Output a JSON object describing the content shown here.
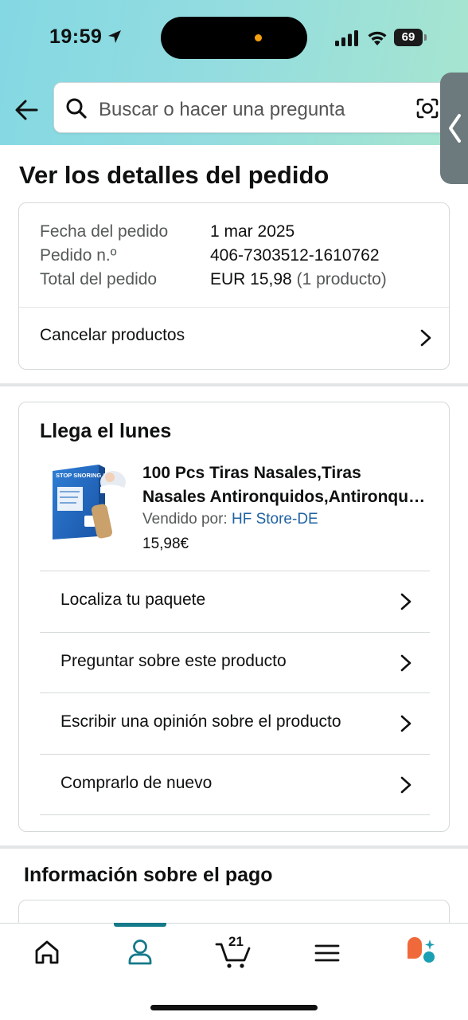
{
  "status_bar": {
    "time": "19:59",
    "battery": "69"
  },
  "search": {
    "placeholder": "Buscar o hacer una pregunta"
  },
  "page_title": "Ver los detalles del pedido",
  "order_summary": {
    "rows": [
      {
        "label": "Fecha del pedido",
        "value": "1 mar 2025"
      },
      {
        "label": "Pedido n.º",
        "value": "406-7303512-1610762"
      },
      {
        "label": "Total del pedido",
        "value": "EUR 15,98",
        "extra": "(1 producto)"
      }
    ],
    "cancel_label": "Cancelar productos"
  },
  "delivery": {
    "title": "Llega el lunes",
    "product": {
      "title_line1": "100 Pcs Tiras Nasales,Tiras",
      "title_line2": "Nasales Antironquidos,Antironquidos",
      "sold_by_label": "Vendido por:",
      "seller": "HF Store-DE",
      "price": "15,98€",
      "image_text": "STOP SNORING STRIPS"
    },
    "actions": [
      "Localiza tu paquete",
      "Preguntar sobre este producto",
      "Escribir una opinión sobre el producto",
      "Comprarlo de nuevo"
    ]
  },
  "payment": {
    "title": "Información sobre el pago"
  },
  "bottom_nav": {
    "items": [
      "home-icon",
      "account-icon",
      "cart-icon",
      "menu-icon",
      "rufus-icon"
    ],
    "active": "account-icon",
    "cart_count": "21"
  },
  "colors": {
    "header_gradient_start": "#84d8e3",
    "header_gradient_end": "#a6e5cf",
    "link": "#2162a1",
    "active_nav": "#157a8a",
    "rufus_orange": "#f0693a"
  }
}
